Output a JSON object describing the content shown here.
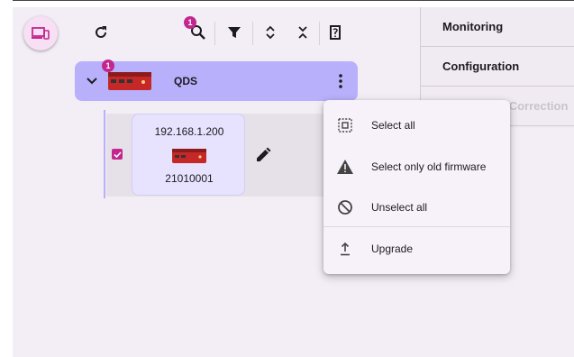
{
  "toolbar": {
    "search_badge": "1",
    "icons": [
      "devices-icon",
      "refresh-icon",
      "search-icon",
      "filter-icon",
      "expand-all-icon",
      "collapse-all-icon",
      "sheet-icon"
    ]
  },
  "tabs": [
    {
      "label": "Monitoring"
    },
    {
      "label": "Configuration"
    },
    {
      "label": "User Offset Correction"
    }
  ],
  "tree": {
    "group": {
      "name": "QDS",
      "badge": "1"
    },
    "device": {
      "ip": "192.168.1.200",
      "serial": "21010001",
      "selected": true
    }
  },
  "context_menu": {
    "items": [
      {
        "label": "Select all",
        "icon": "select-all-icon"
      },
      {
        "label": "Select only old firmware",
        "icon": "warning-icon"
      },
      {
        "label": "Unselect all",
        "icon": "block-icon"
      },
      {
        "label": "Upgrade",
        "icon": "upgrade-icon"
      }
    ]
  },
  "colors": {
    "accent": "#c2278f",
    "group_row": "#b9b0fb",
    "card": "#e7e3ff",
    "background": "#f3edf5"
  }
}
